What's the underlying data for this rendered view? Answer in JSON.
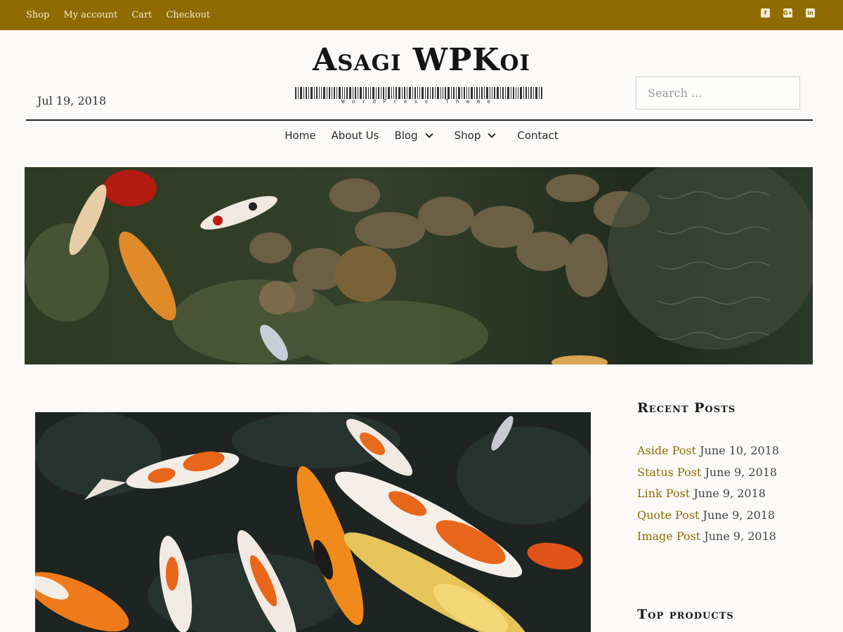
{
  "top_menu": [
    "Shop",
    "My account",
    "Cart",
    "Checkout"
  ],
  "social_icons": [
    "facebook-icon",
    "google-plus-icon",
    "linkedin-icon"
  ],
  "social_glyphs": [
    "f",
    "G+",
    "in"
  ],
  "header": {
    "date": "Jul 19, 2018",
    "site_title": "Asagi WPKoi",
    "tagline": "WordPress Theme",
    "search_placeholder": "Search ..."
  },
  "nav": [
    {
      "label": "Home",
      "has_submenu": false
    },
    {
      "label": "About Us",
      "has_submenu": false
    },
    {
      "label": "Blog",
      "has_submenu": true
    },
    {
      "label": "Shop",
      "has_submenu": true
    },
    {
      "label": "Contact",
      "has_submenu": false
    }
  ],
  "sidebar": {
    "recent_title": "Recent Posts",
    "recent_posts": [
      {
        "title": "Aside Post",
        "date": "June 10, 2018"
      },
      {
        "title": "Status Post",
        "date": "June 9, 2018"
      },
      {
        "title": "Link Post",
        "date": "June 9, 2018"
      },
      {
        "title": "Quote Post",
        "date": "June 9, 2018"
      },
      {
        "title": "Image Post",
        "date": "June 9, 2018"
      }
    ],
    "products_title": "Top products"
  },
  "colors": {
    "accent": "#8f6b00",
    "text": "#222222",
    "background": "#fbfaf8"
  }
}
